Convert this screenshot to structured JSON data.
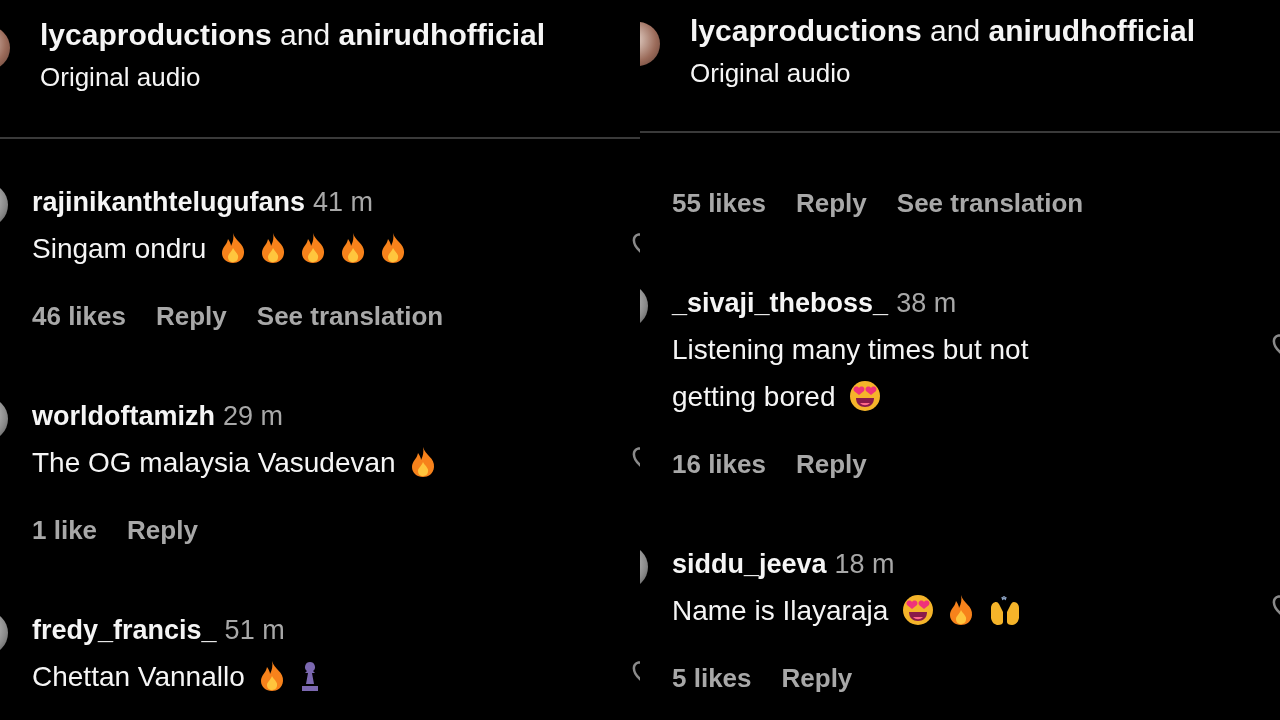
{
  "panels": [
    {
      "header": {
        "title": "**lycaproductions** and **anirudhofficial**",
        "subtitle": "Original audio"
      },
      "comments": [
        {
          "username": "rajinikanthtelugufans",
          "time": "41 m",
          "text": "Singam ondru",
          "emojis": [
            {
              "kind": "flame"
            },
            {
              "kind": "flame"
            },
            {
              "kind": "flame"
            },
            {
              "kind": "flame"
            },
            {
              "kind": "flame"
            }
          ],
          "likes": "46 likes",
          "reply": "Reply",
          "see_translation": "See translation"
        },
        {
          "username": "worldoftamizh",
          "time": "29 m",
          "text": "The OG malaysia Vasudevan",
          "emojis": [
            {
              "kind": "flame"
            }
          ],
          "likes": "1 like",
          "reply": "Reply"
        },
        {
          "username": "fredy_francis_",
          "time": "51 m",
          "text": "Chettan Vannallo",
          "emojis": [
            {
              "kind": "flame"
            },
            {
              "kind": "pawn"
            }
          ]
        }
      ]
    },
    {
      "header": {
        "title": "**lycaproductions** and **anirudhofficial**",
        "subtitle": "Original audio"
      },
      "comments": [
        {
          "likes": "55 likes",
          "reply": "Reply",
          "see_translation": "See translation"
        },
        {
          "username": "_sivaji_theboss_",
          "time": "38 m",
          "text": [
            "Listening many times but not",
            "getting bored"
          ],
          "emojis": [
            {
              "kind": "heart-eyes"
            }
          ],
          "likes": "16 likes",
          "reply": "Reply"
        },
        {
          "username": "siddu_jeeva",
          "time": "18 m",
          "text": "Name is Ilayaraja",
          "emojis": [
            {
              "kind": "heart-eyes"
            },
            {
              "kind": "flame"
            },
            {
              "kind": "raised-hands"
            }
          ],
          "likes": "5 likes",
          "reply": "Reply"
        }
      ]
    }
  ]
}
